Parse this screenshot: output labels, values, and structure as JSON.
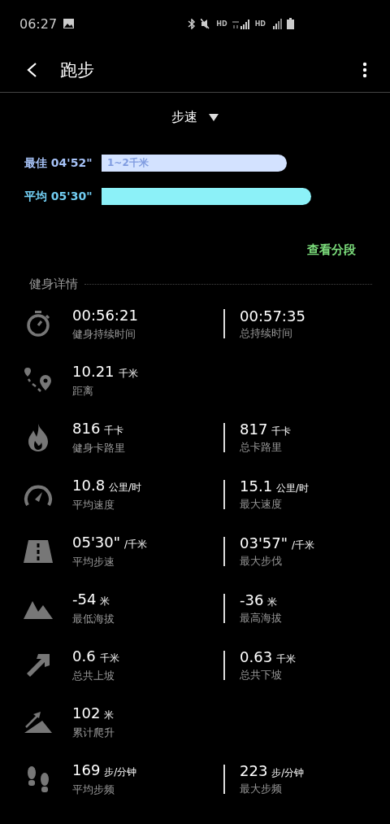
{
  "status_bar": {
    "time": "06:27",
    "indicators": [
      "HD",
      "HD"
    ]
  },
  "header": {
    "title": "跑步"
  },
  "chart": {
    "dropdown": "步速",
    "bars": [
      {
        "label": "最佳 04'52\"",
        "inner_label": "1~2千米",
        "color": "#d3e2ff"
      },
      {
        "label": "平均 05'30\"",
        "color": "#8cf1f8"
      }
    ],
    "link": "查看分段"
  },
  "section_title": "健身详情",
  "metrics": [
    {
      "kind": "stopwatch",
      "left": {
        "value": "00:56:21",
        "label": "健身持续时间"
      },
      "right": {
        "value": "00:57:35",
        "label": "总持续时间"
      }
    },
    {
      "kind": "route",
      "left": {
        "value": "10.21",
        "unit": "千米",
        "label": "距离"
      }
    },
    {
      "kind": "flame",
      "left": {
        "value": "816",
        "unit": "千卡",
        "label": "健身卡路里"
      },
      "right": {
        "value": "817",
        "unit": "千卡",
        "label": "总卡路里"
      }
    },
    {
      "kind": "speedometer",
      "left": {
        "value": "10.8",
        "unit": "公里/时",
        "label": "平均速度"
      },
      "right": {
        "value": "15.1",
        "unit": "公里/时",
        "label": "最大速度"
      }
    },
    {
      "kind": "road",
      "left": {
        "value": "05'30\"",
        "unit": "/千米",
        "label": "平均步速"
      },
      "right": {
        "value": "03'57\"",
        "unit": "/千米",
        "label": "最大步伐"
      }
    },
    {
      "kind": "mountain",
      "left": {
        "value": "-54",
        "unit": "米",
        "label": "最低海拔"
      },
      "right": {
        "value": "-36",
        "unit": "米",
        "label": "最高海拔"
      }
    },
    {
      "kind": "arrow",
      "left": {
        "value": "0.6",
        "unit": "千米",
        "label": "总共上坡"
      },
      "right": {
        "value": "0.63",
        "unit": "千米",
        "label": "总共下坡"
      }
    },
    {
      "kind": "climb",
      "left": {
        "value": "102",
        "unit": "米",
        "label": "累计爬升"
      }
    },
    {
      "kind": "footprints",
      "left": {
        "value": "169",
        "unit": "步/分钟",
        "label": "平均步频"
      },
      "right": {
        "value": "223",
        "unit": "步/分钟",
        "label": "最大步频"
      }
    }
  ]
}
